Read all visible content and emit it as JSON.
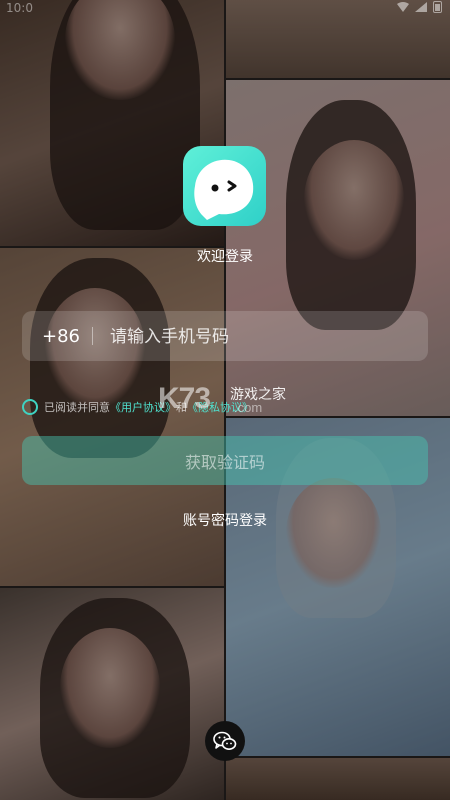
{
  "status_bar": {
    "time": "10:0"
  },
  "welcome": "欢迎登录",
  "phone": {
    "country_code": "+86",
    "placeholder": "请输入手机号码",
    "value": ""
  },
  "agreement": {
    "prefix": "已阅读并同意",
    "link1": "《用户协议》",
    "separator": "和",
    "link2": "《隐私协议》"
  },
  "watermark": {
    "logo": "K73",
    "name": "游戏之家",
    "domain": ".com"
  },
  "actions": {
    "get_code": "获取验证码",
    "password_login": "账号密码登录"
  },
  "icons": {
    "logo": "app-logo-icon",
    "wechat": "wechat-icon"
  },
  "colors": {
    "accent": "#3fd3c2",
    "logo": "#45e3cf",
    "button": "#46c8b4"
  }
}
